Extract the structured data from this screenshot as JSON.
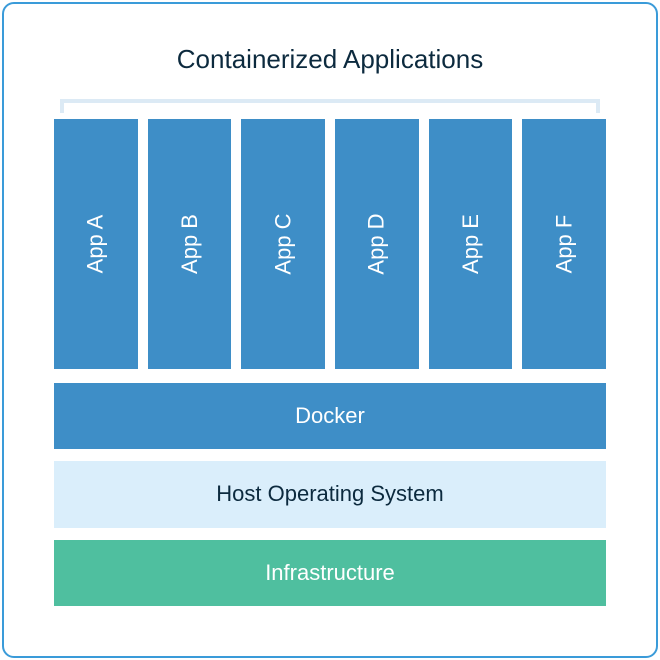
{
  "title": "Containerized Applications",
  "apps": {
    "0": "App A",
    "1": "App B",
    "2": "App C",
    "3": "App D",
    "4": "App E",
    "5": "App F"
  },
  "layers": {
    "docker": "Docker",
    "host_os": "Host Operating System",
    "infrastructure": "Infrastructure"
  },
  "colors": {
    "app_bg": "#3e8ec7",
    "docker_bg": "#3e8ec7",
    "host_os_bg": "#daeefb",
    "infrastructure_bg": "#4fbf9f",
    "border": "#3a9bd9"
  }
}
